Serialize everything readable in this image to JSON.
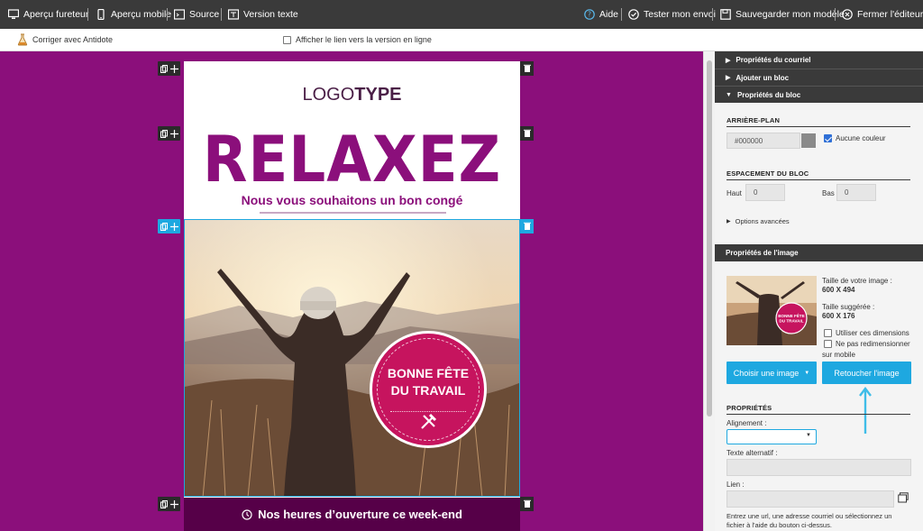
{
  "toolbar": {
    "left": [
      {
        "label": "Aperçu fureteur",
        "icon": "monitor-icon"
      },
      {
        "label": "Aperçu mobile",
        "icon": "mobile-icon"
      },
      {
        "label": "Source",
        "icon": "source-icon"
      },
      {
        "label": "Version texte",
        "icon": "text-version-icon"
      }
    ],
    "right": [
      {
        "label": "Aide",
        "icon": "help-icon"
      },
      {
        "label": "Tester mon envoi",
        "icon": "check-circle-icon"
      },
      {
        "label": "Sauvegarder mon modèle",
        "icon": "save-icon"
      },
      {
        "label": "Fermer l'éditeur",
        "icon": "close-circle-icon"
      }
    ]
  },
  "subbar": {
    "antidote_label": "Corriger avec Antidote",
    "online_link_label": "Afficher le lien vers la version en ligne"
  },
  "email": {
    "logo_light": "LOGO",
    "logo_bold": "TYPE",
    "headline": "RELAXEZ",
    "subheadline": "Nous vous souhaitons un bon congé",
    "badge_line1": "BONNE FÊTE",
    "badge_line2": "DU TRAVAIL",
    "footer_text": "Nos heures d’ouverture ce week-end"
  },
  "panel": {
    "acc_courriel": "Propriétés du courriel",
    "acc_ajouter": "Ajouter un bloc",
    "acc_bloc": "Propriétés du bloc",
    "bg_title": "ARRIÈRE-PLAN",
    "bg_value": "#000000",
    "bg_swatch_color": "#8a8a8a",
    "no_color_label": "Aucune couleur",
    "spacing_title": "ESPACEMENT DU BLOC",
    "top_label": "Haut",
    "top_value": "0",
    "bottom_label": "Bas",
    "bottom_value": "0",
    "advanced_label": "Options avancées",
    "image_props_title": "Propriétés de l'image",
    "image_size_label": "Taille de votre image :",
    "image_size_value": "600 X 494",
    "suggested_label": "Taille suggérée :",
    "suggested_value": "600 X 176",
    "use_dims_label": "Utiliser ces dimensions",
    "no_resize_label": "Ne pas redimensionner",
    "no_resize_label2": "sur mobile",
    "choose_image_label": "Choisir une image",
    "retouch_label": "Retoucher l'image",
    "props_title": "PROPRIÉTÉS",
    "align_label": "Alignement :",
    "alt_label": "Texte alternatif :",
    "link_label": "Lien :",
    "help_text_1": "Entrez une url, une adresse courriel ou sélectionnez un",
    "help_text_2": "fichier à l'aide du bouton ci-dessus."
  },
  "colors": {
    "canvas": "#8b0f7b",
    "accent": "#1ea8e0",
    "dark": "#3a3a3a"
  }
}
